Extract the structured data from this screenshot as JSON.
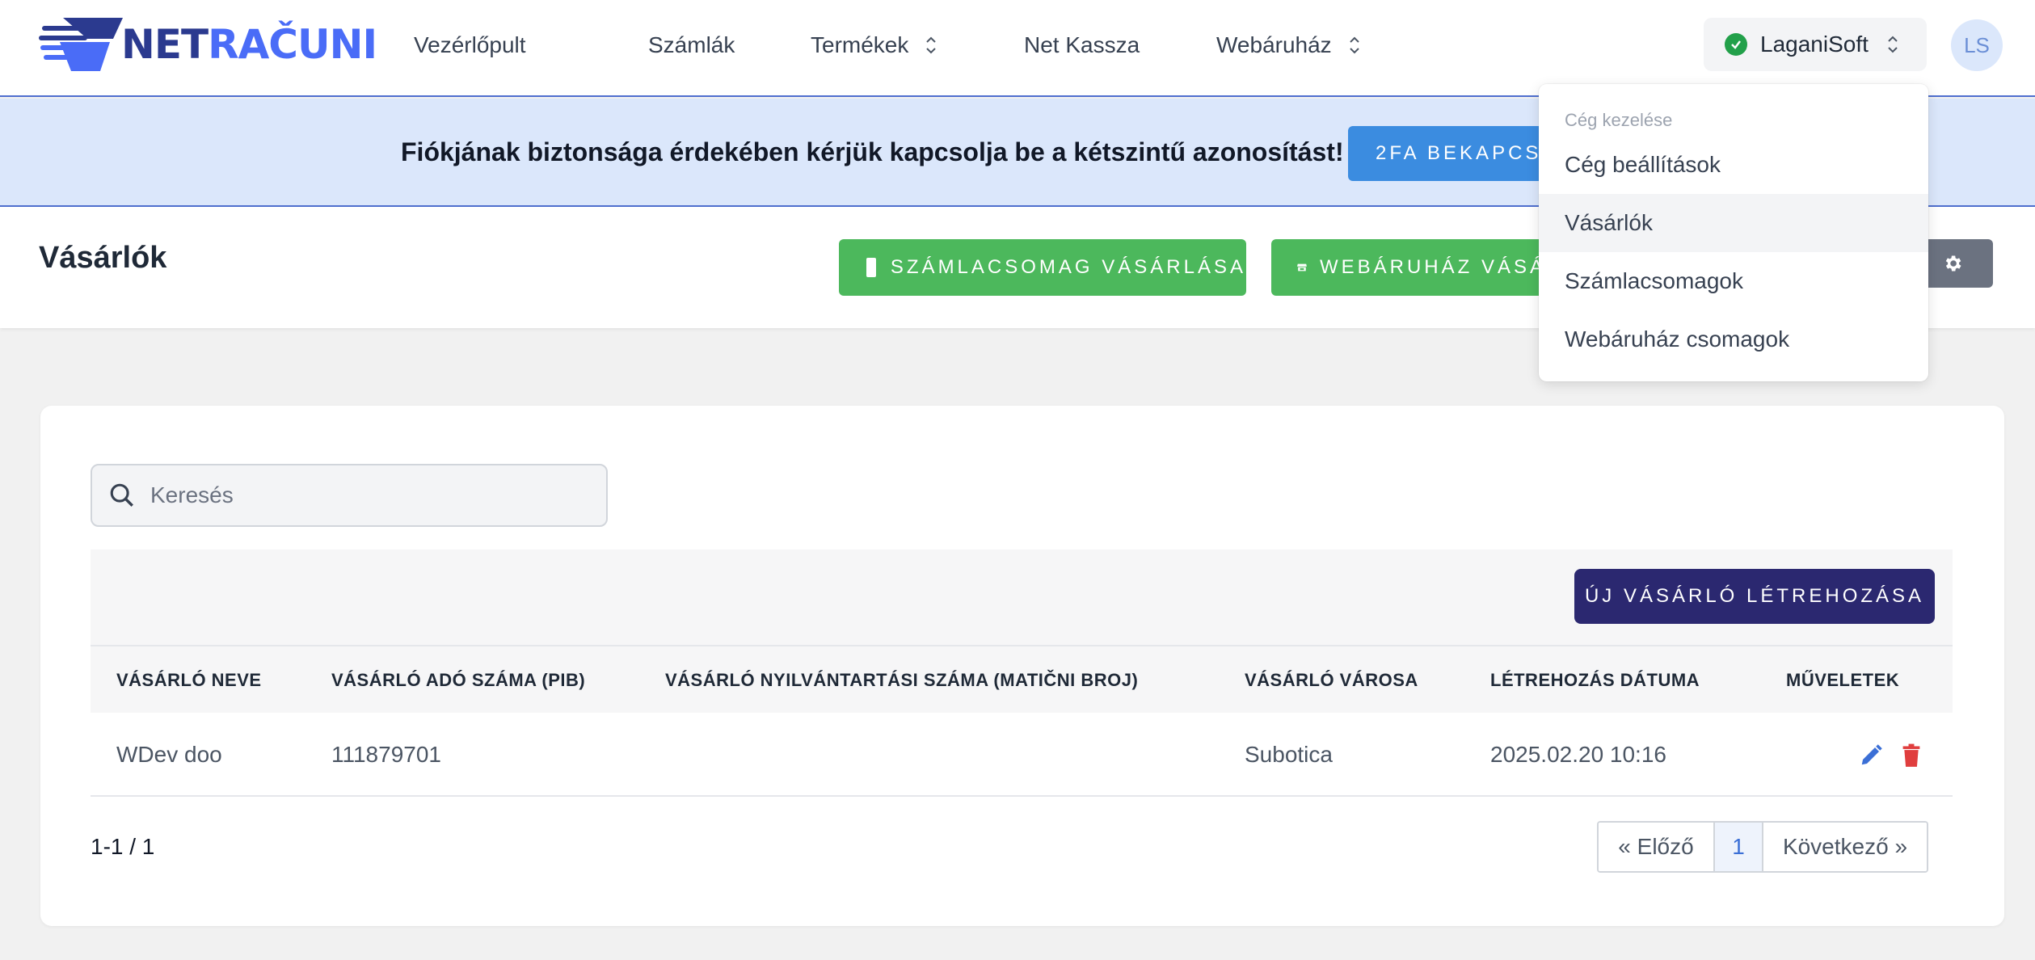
{
  "nav": {
    "logo": {
      "part1": "NET",
      "part2": "RAČUNI"
    },
    "items": [
      {
        "label": "Vezérlőpult"
      },
      {
        "label": "Számlák"
      },
      {
        "label": "Termékek"
      },
      {
        "label": "Net Kassza"
      },
      {
        "label": "Webáruház"
      }
    ],
    "company": "LaganiSoft",
    "avatar": "LS"
  },
  "banner": {
    "text": "Fiókjának biztonsága érdekében kérjük kapcsolja be a kétszintű azonosítást!",
    "button": "2FA BEKAPCSO"
  },
  "header": {
    "title": "Vásárlók",
    "buy_invoices_button": "SZÁMLACSOMAG VÁSÁRLÁSA",
    "buy_webshop_button": "WEBÁRUHÁZ VÁSÁ"
  },
  "dropdown": {
    "header": "Cég kezelése",
    "items": [
      {
        "label": "Cég beállítások"
      },
      {
        "label": "Vásárlók"
      },
      {
        "label": "Számlacsomagok"
      },
      {
        "label": "Webáruház csomagok"
      }
    ]
  },
  "search": {
    "placeholder": "Keresés"
  },
  "table": {
    "new_button": "ÚJ VÁSÁRLÓ LÉTREHOZÁSA",
    "columns": [
      "VÁSÁRLÓ NEVE",
      "VÁSÁRLÓ ADÓ SZÁMA (PIB)",
      "VÁSÁRLÓ NYILVÁNTARTÁSI SZÁMA (MATIČNI BROJ)",
      "VÁSÁRLÓ VÁROSA",
      "LÉTREHOZÁS DÁTUMA",
      "MŰVELETEK"
    ],
    "rows": [
      {
        "name": "WDev doo",
        "pib": "111879701",
        "mb": "",
        "city": "Subotica",
        "created": "2025.02.20 10:16"
      }
    ]
  },
  "pagination": {
    "count": "1-1 / 1",
    "prev": "« Előző",
    "current": "1",
    "next": "Következő »"
  },
  "colors": {
    "brand_dark": "#2b3a8f",
    "brand_light": "#4a6cf7",
    "banner_bg": "#dbe7fb",
    "green": "#4cb85c",
    "primary_dark": "#2b2870",
    "edit": "#3b6fd6",
    "delete": "#e03e3e"
  }
}
